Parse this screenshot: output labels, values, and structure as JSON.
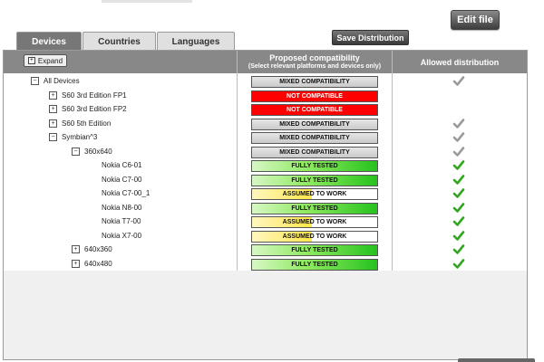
{
  "toolbar": {
    "edit_label": "Edit file",
    "save_distribution_label": "Save Distribution"
  },
  "tabs": [
    {
      "label": "Devices",
      "active": true
    },
    {
      "label": "Countries",
      "active": false
    },
    {
      "label": "Languages",
      "active": false
    }
  ],
  "header": {
    "expand_label": "Expand",
    "compat_title": "Proposed compatibility",
    "compat_sub": "(Select relevant platforms and devices only)",
    "allowed_title": "Allowed distribution"
  },
  "colors": {
    "not_compatible": "#ff0000",
    "fully_tested": "#26c21e",
    "assumed": "#ffe64a",
    "mixed": "#cacaca"
  },
  "rows": [
    {
      "label": "All Devices",
      "toggle": "−",
      "status": "MIXED COMPATIBILITY",
      "status_type": "mixed",
      "allowed": "grey-check-icon"
    },
    {
      "label": "S60 3rd Edition FP1",
      "toggle": "+",
      "status": "NOT COMPATIBLE",
      "status_type": "not",
      "allowed": ""
    },
    {
      "label": "S60 3rd Edition FP2",
      "toggle": "+",
      "status": "NOT COMPATIBLE",
      "status_type": "not",
      "allowed": ""
    },
    {
      "label": "S60 5th Edition",
      "toggle": "+",
      "status": "MIXED COMPATIBILITY",
      "status_type": "mixed",
      "allowed": "grey-check-icon"
    },
    {
      "label": "Symbian^3",
      "toggle": "−",
      "status": "MIXED COMPATIBILITY",
      "status_type": "mixed",
      "allowed": "grey-check-icon"
    },
    {
      "label": "360x640",
      "toggle": "−",
      "status": "MIXED COMPATIBILITY",
      "status_type": "mixed",
      "allowed": "grey-check-icon"
    },
    {
      "label": "Nokia C6-01",
      "toggle": "",
      "status": "FULLY TESTED",
      "status_type": "full",
      "allowed": "green-check-icon"
    },
    {
      "label": "Nokia C7-00",
      "toggle": "",
      "status": "FULLY TESTED",
      "status_type": "full",
      "allowed": "green-check-icon"
    },
    {
      "label": "Nokia C7-00_1",
      "toggle": "",
      "status": "ASSUMED TO WORK",
      "status_type": "assumed",
      "allowed": "green-check-icon"
    },
    {
      "label": "Nokia N8-00",
      "toggle": "",
      "status": "FULLY TESTED",
      "status_type": "full",
      "allowed": "green-check-icon"
    },
    {
      "label": "Nokia T7-00",
      "toggle": "",
      "status": "ASSUMED TO WORK",
      "status_type": "assumed",
      "allowed": "green-check-icon"
    },
    {
      "label": "Nokia X7-00",
      "toggle": "",
      "status": "ASSUMED TO WORK",
      "status_type": "assumed",
      "allowed": "green-check-icon"
    },
    {
      "label": "640x360",
      "toggle": "+",
      "status": "FULLY TESTED",
      "status_type": "full",
      "allowed": "green-check-icon"
    },
    {
      "label": "640x480",
      "toggle": "+",
      "status": "FULLY TESTED",
      "status_type": "full",
      "allowed": "green-check-icon"
    }
  ]
}
